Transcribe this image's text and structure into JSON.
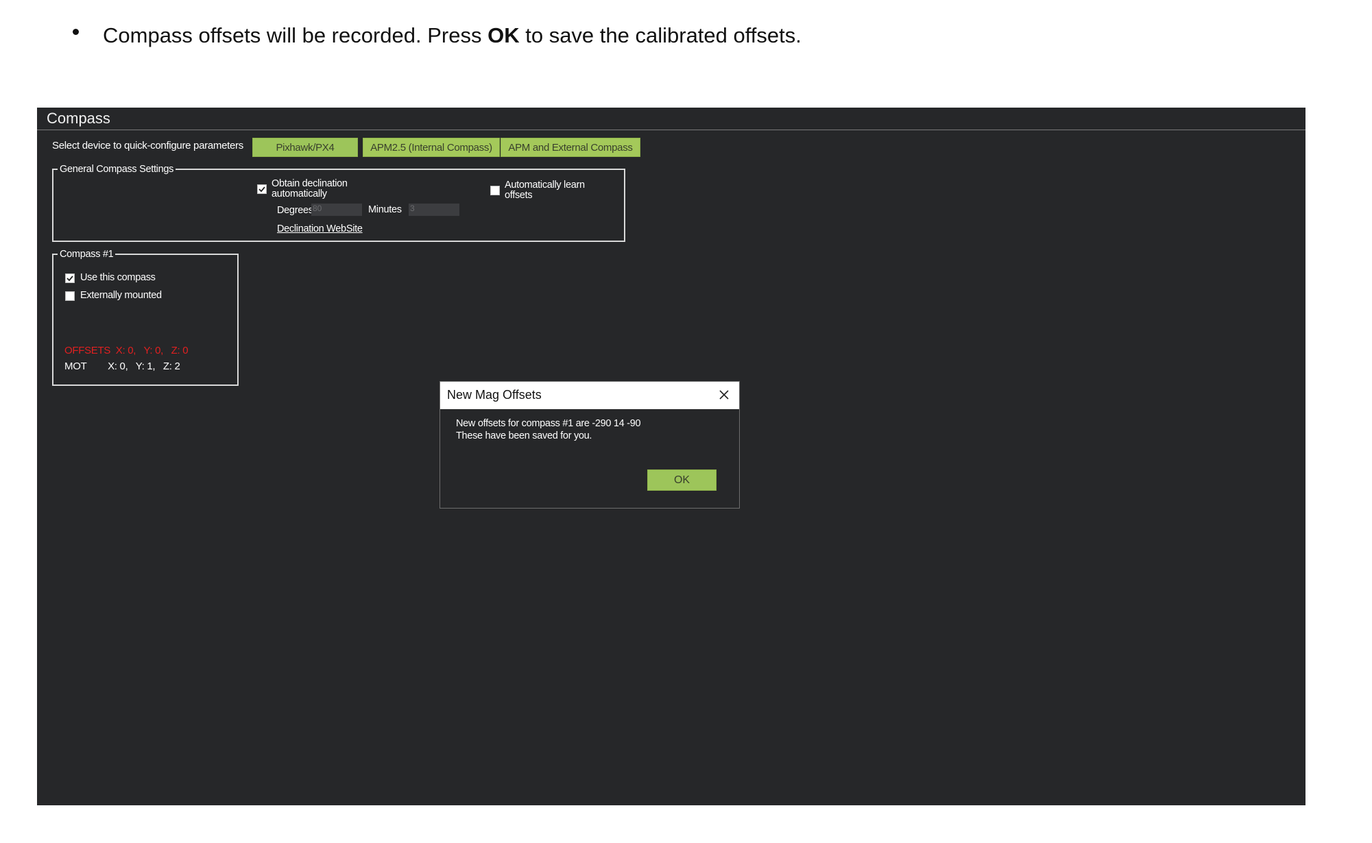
{
  "instruction": {
    "text_before": "Compass offsets will be recorded. Press ",
    "bold": "OK",
    "text_after": " to save the calibrated offsets."
  },
  "app": {
    "title": "Compass",
    "quick_config": {
      "label": "Select device to quick-configure parameters",
      "buttons": [
        "Pixhawk/PX4",
        "APM2.5 (Internal Compass)",
        "APM and External Compass"
      ]
    },
    "general_settings": {
      "legend": "General Compass Settings",
      "obtain_declination_label": "Obtain declination automatically",
      "obtain_declination_checked": true,
      "degrees_label": "Degrees",
      "degrees_value": "80",
      "minutes_label": "Minutes",
      "minutes_value": "3",
      "declination_link": "Declination WebSite",
      "auto_learn_label": "Automatically learn offsets",
      "auto_learn_checked": false
    },
    "compass1": {
      "legend": "Compass #1",
      "use_label": "Use this compass",
      "use_checked": true,
      "external_label": "Externally mounted",
      "external_checked": false,
      "offsets_text": "OFFSETS  X: 0,   Y: 0,   Z: 0",
      "mot_text": "MOT        X: 0,   Y: 1,   Z: 2"
    }
  },
  "dialog": {
    "title": "New Mag Offsets",
    "message_line1": "New offsets for compass #1 are -290 14 -90",
    "message_line2": "These have been saved for you.",
    "ok_label": "OK"
  },
  "colors": {
    "panel_bg": "#262729",
    "button_green": "#a4c95a",
    "offsets_red": "#e02020"
  }
}
